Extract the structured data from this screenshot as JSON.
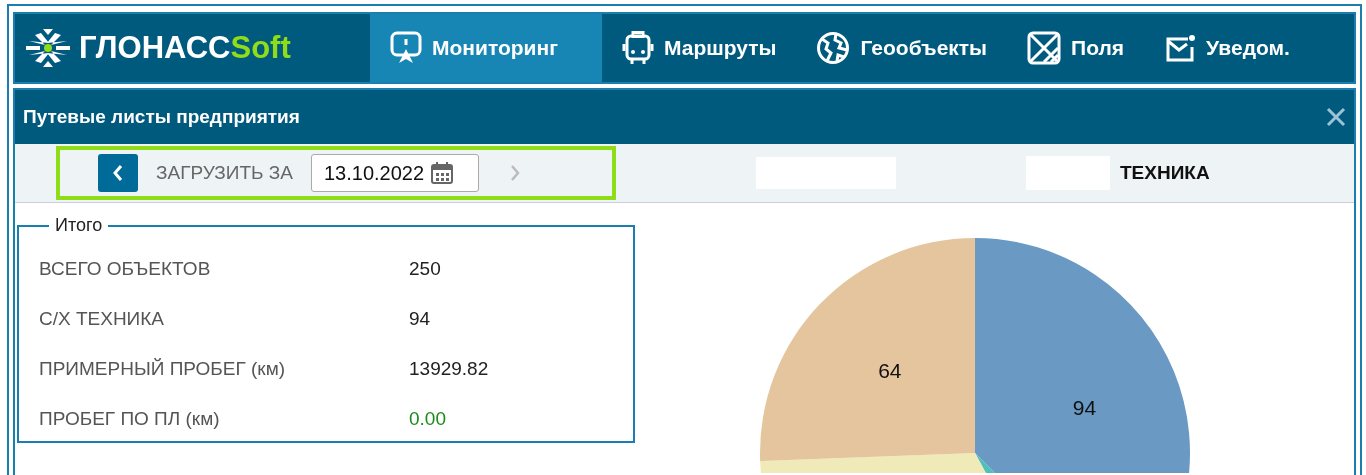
{
  "logo": {
    "text": "ГЛОНАСС",
    "accent": "Soft"
  },
  "nav": [
    {
      "label": "Мониторинг",
      "selected": true
    },
    {
      "label": "Маршруты",
      "selected": false
    },
    {
      "label": "Геообъекты",
      "selected": false
    },
    {
      "label": "Поля",
      "selected": false
    },
    {
      "label": "Уведом.",
      "selected": false
    }
  ],
  "panel": {
    "title": "Путевые листы предприятия"
  },
  "toolbar": {
    "load_label": "ЗАГРУЗИТЬ ЗА",
    "date": "13.10.2022"
  },
  "view_tabs": [
    {
      "selected": false
    },
    {
      "label": "ТЕХНИКА",
      "selected": true
    }
  ],
  "summary": {
    "legend": "Итого",
    "rows": [
      {
        "label": "ВСЕГО ОБЪЕКТОВ",
        "value": "250",
        "color": "#222222"
      },
      {
        "label": "С/Х ТЕХНИКА",
        "value": "94",
        "color": "#222222"
      },
      {
        "label": "ПРИМЕРНЫЙ ПРОБЕГ (км)",
        "value": "13929.82",
        "color": "#222222"
      },
      {
        "label": "ПРОБЕГ ПО ПЛ (км)",
        "value": "0.00",
        "color": "#1a8a1a"
      }
    ]
  },
  "pie": {
    "slices": [
      {
        "label": "94",
        "color": "#6a9ac4"
      },
      {
        "color": "#4fc1b8"
      },
      {
        "color": "#f0eab8"
      },
      {
        "label": "64",
        "color": "#e4c59e"
      }
    ]
  }
}
